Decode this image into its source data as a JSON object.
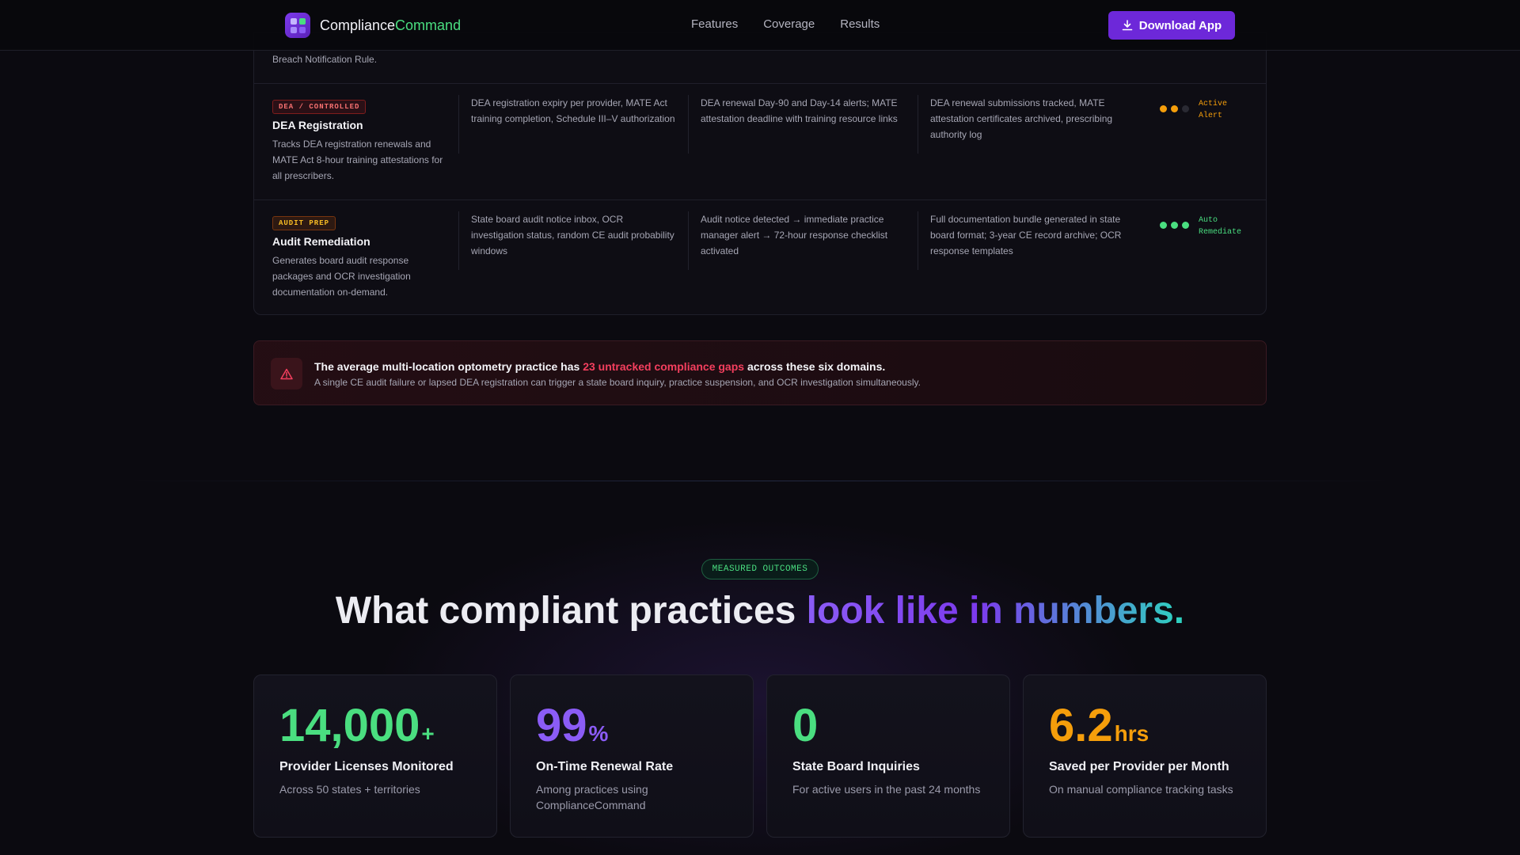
{
  "nav": {
    "brand_main": "Compliance",
    "brand_accent": "Command",
    "links": [
      "Features",
      "Coverage",
      "Results"
    ],
    "download_label": "Download App"
  },
  "table": {
    "top_text": "Breach Notification Rule.",
    "rows": [
      {
        "badge": "DEA / CONTROLLED",
        "title": "DEA Registration",
        "desc": "Tracks DEA registration renewals and MATE Act 8-hour training attestations for all prescribers.",
        "c1": "DEA registration expiry per provider, MATE Act training completion, Schedule III–V authorization",
        "c2": "DEA renewal Day-90 and Day-14 alerts; MATE attestation deadline with training resource links",
        "c3": "DEA renewal submissions tracked, MATE attestation certificates archived, prescribing authority log",
        "status_line1": "Active",
        "status_line2": "Alert",
        "status_color": "#f59e0b"
      },
      {
        "badge": "AUDIT PREP",
        "title": "Audit Remediation",
        "desc": "Generates board audit response packages and OCR investigation documentation on-demand.",
        "c1": "State board audit notice inbox, OCR investigation status, random CE audit probability windows",
        "c2": "Audit notice detected → immediate practice manager alert → 72-hour response checklist activated",
        "c3": "Full documentation bundle generated in state board format; 3-year CE record archive; OCR response templates",
        "status_line1": "Auto",
        "status_line2": "Remediate",
        "status_color": "#4ade80"
      }
    ]
  },
  "alert": {
    "head_pre": "The average multi-location optometry practice has ",
    "head_highlight": "23 untracked compliance gaps",
    "head_post": " across these six domains.",
    "sub": "A single CE audit failure or lapsed DEA registration can trigger a state board inquiry, practice suspension, and OCR investigation simultaneously."
  },
  "outcomes": {
    "pill": "MEASURED OUTCOMES",
    "headline_plain": "What compliant practices ",
    "headline_gradient": "look like in numbers.",
    "stats": [
      {
        "value": "14,000",
        "unit": "+",
        "label": "Provider Licenses Monitored",
        "sub": "Across 50 states + territories",
        "color": "#4ade80"
      },
      {
        "value": "99",
        "unit": "%",
        "label": "On-Time Renewal Rate",
        "sub": "Among practices using ComplianceCommand",
        "color": "#8b5cf6"
      },
      {
        "value": "0",
        "unit": "",
        "label": "State Board Inquiries",
        "sub": "For active users in the past 24 months",
        "color": "#4ade80"
      },
      {
        "value": "6.2",
        "unit": "hrs",
        "label": "Saved per Provider per Month",
        "sub": "On manual compliance tracking tasks",
        "color": "#f59e0b"
      }
    ]
  },
  "colors": {
    "accent_purple": "#6d28d9",
    "accent_green": "#4ade80",
    "alert_red": "#f43f5e"
  }
}
